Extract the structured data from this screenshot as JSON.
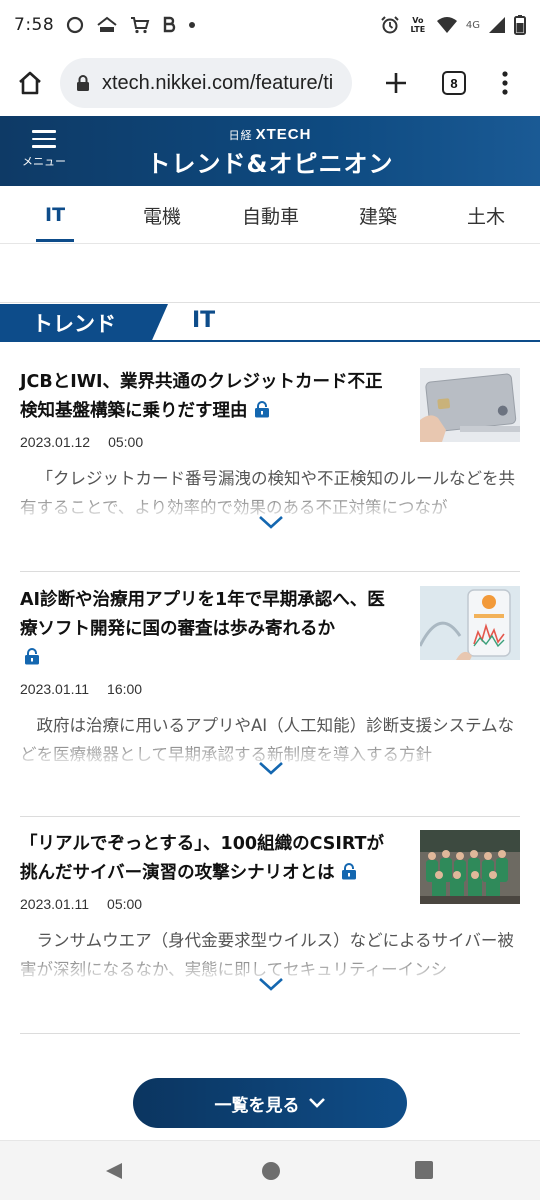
{
  "status_bar": {
    "time": "7:58",
    "network": "4G",
    "volte": "Vo LTE"
  },
  "browser": {
    "url": "xtech.nikkei.com/feature/ti",
    "tab_count": "8"
  },
  "header": {
    "menu_label": "メニュー",
    "logo_small": "日経",
    "logo_brand": "XTECH",
    "site_title": "トレンド&オピニオン",
    "accent_color": "#0d4c8a"
  },
  "category_tabs": [
    {
      "label": "IT",
      "active": true
    },
    {
      "label": "電機",
      "active": false
    },
    {
      "label": "自動車",
      "active": false
    },
    {
      "label": "建築",
      "active": false
    },
    {
      "label": "土木",
      "active": false
    }
  ],
  "section": {
    "badge": "トレンド",
    "label": "IT"
  },
  "articles": [
    {
      "title": "JCBとIWI、業界共通のクレジットカード不正検知基盤構築に乗りだす理由",
      "date": "2023.01.12",
      "time": "05:00",
      "locked": true,
      "summary": "「クレジットカード番号漏洩の検知や不正検知のルールなどを共有することで、より効率的で効果のある不正対策につなが"
    },
    {
      "title": "AI診断や治療用アプリを1年で早期承認へ、医療ソフト開発に国の審査は歩み寄れるか",
      "date": "2023.01.11",
      "time": "16:00",
      "locked": true,
      "summary": "政府は治療に用いるアプリやAI（人工知能）診断支援システムなどを医療機器として早期承認する新制度を導入する方針"
    },
    {
      "title": "「リアルでぞっとする」、100組織のCSIRTが挑んだサイバー演習の攻撃シナリオとは",
      "date": "2023.01.11",
      "time": "05:00",
      "locked": true,
      "summary": "ランサムウエア（身代金要求型ウイルス）などによるサイバー被害が深刻になるなか、実態に即してセキュリティーインシ"
    }
  ],
  "more_button": {
    "label": "一覧を見る"
  }
}
